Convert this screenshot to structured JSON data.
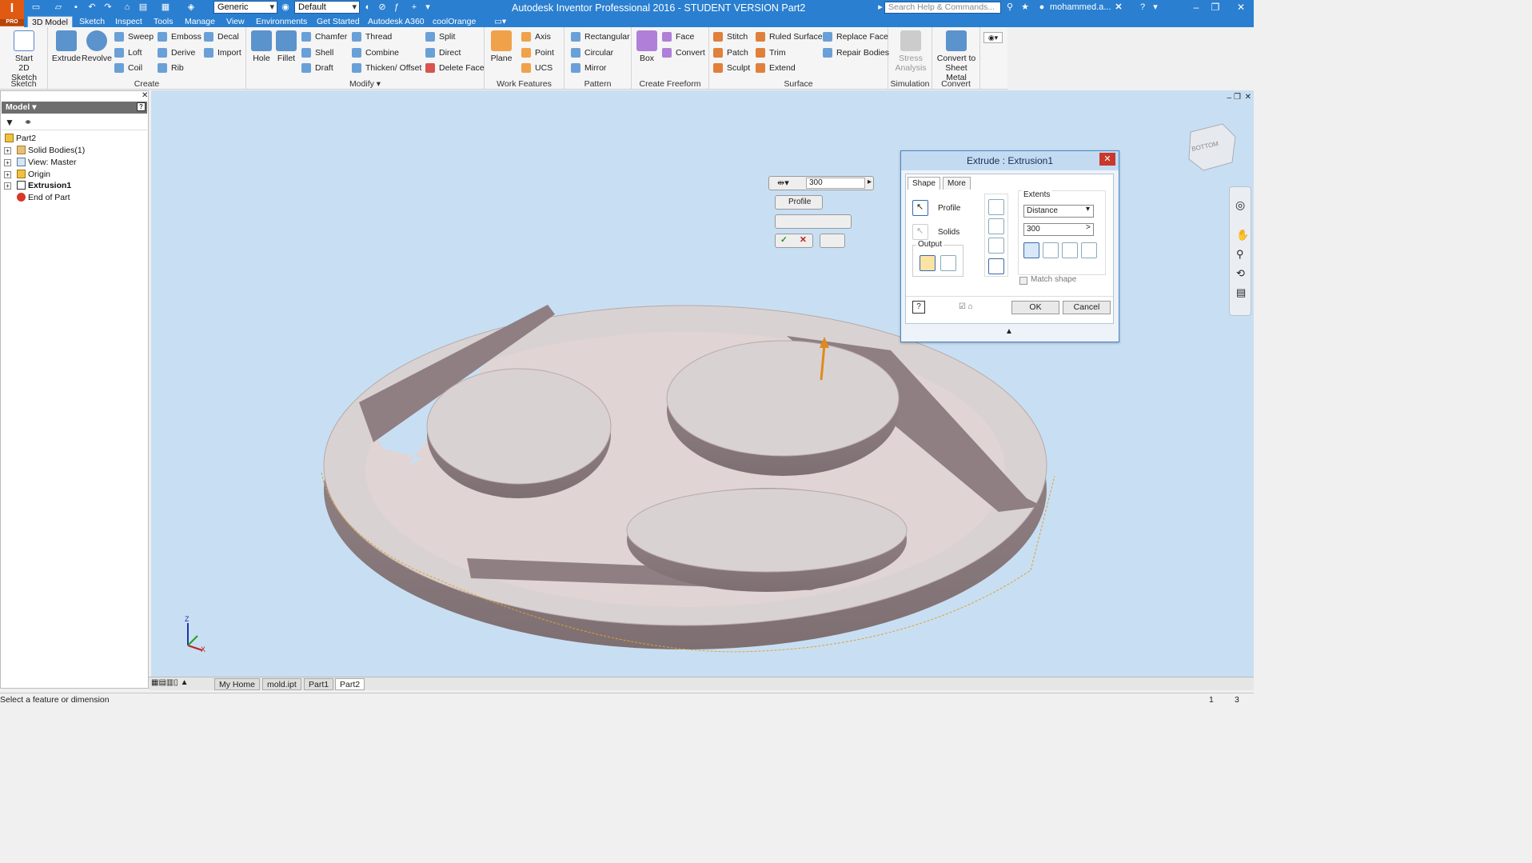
{
  "app": {
    "logo": "I",
    "logo_sub": "PRO",
    "title": "Autodesk Inventor Professional 2016 - STUDENT VERSION    Part2",
    "appearance": "Generic",
    "style": "Default",
    "search_placeholder": "Search Help & Commands...",
    "user": "mohammed.a..."
  },
  "ribbon_tabs": [
    "3D Model",
    "Sketch",
    "Inspect",
    "Tools",
    "Manage",
    "View",
    "Environments",
    "Get Started",
    "Autodesk A360",
    "coolOrange"
  ],
  "active_tab": "3D Model",
  "ribbon": {
    "sketch": {
      "label": "Sketch",
      "start": "Start",
      "start2": "2D Sketch"
    },
    "create": {
      "label": "Create",
      "extrude": "Extrude",
      "revolve": "Revolve",
      "sweep": "Sweep",
      "loft": "Loft",
      "coil": "Coil",
      "emboss": "Emboss",
      "derive": "Derive",
      "rib": "Rib",
      "decal": "Decal",
      "import": "Import"
    },
    "modify": {
      "label": "Modify ▾",
      "hole": "Hole",
      "fillet": "Fillet",
      "chamfer": "Chamfer",
      "shell": "Shell",
      "draft": "Draft",
      "thread": "Thread",
      "combine": "Combine",
      "thicken": "Thicken/ Offset",
      "split": "Split",
      "direct": "Direct",
      "delete_face": "Delete Face"
    },
    "work_features": {
      "label": "Work Features",
      "plane": "Plane",
      "axis": "Axis",
      "point": "Point",
      "ucs": "UCS"
    },
    "pattern": {
      "label": "Pattern",
      "rectangular": "Rectangular",
      "circular": "Circular",
      "mirror": "Mirror"
    },
    "freeform": {
      "label": "Create Freeform",
      "box": "Box",
      "face": "Face",
      "convert": "Convert"
    },
    "surface": {
      "label": "Surface",
      "stitch": "Stitch",
      "patch": "Patch",
      "sculpt": "Sculpt",
      "ruled": "Ruled Surface",
      "trim": "Trim",
      "extend": "Extend",
      "replace": "Replace Face",
      "repair": "Repair Bodies"
    },
    "simulation": {
      "label": "Simulation",
      "stress1": "Stress",
      "stress2": "Analysis"
    },
    "convert": {
      "label": "Convert",
      "sm1": "Convert to",
      "sm2": "Sheet Metal"
    }
  },
  "model_panel": {
    "title": "Model ▾",
    "items": [
      {
        "label": "Part2"
      },
      {
        "label": "Solid Bodies(1)"
      },
      {
        "label": "View: Master"
      },
      {
        "label": "Origin"
      },
      {
        "label": "Extrusion1"
      },
      {
        "label": "End of Part"
      }
    ]
  },
  "minitoolbar": {
    "distance": "300",
    "profile": "Profile"
  },
  "dialog": {
    "title": "Extrude : Extrusion1",
    "tabs": [
      "Shape",
      "More"
    ],
    "profile_label": "Profile",
    "solids_label": "Solids",
    "output_label": "Output",
    "extents_label": "Extents",
    "extents_value": "Distance",
    "distance_value": "300",
    "match_shape": "Match shape",
    "ok": "OK",
    "cancel": "Cancel"
  },
  "viewcube_label": "BOTTOM",
  "doc_tabs": [
    "My Home",
    "mold.ipt",
    "Part1",
    "Part2"
  ],
  "active_doc": "Part2",
  "status": {
    "text": "Select a feature or dimension",
    "n1": "1",
    "n2": "3"
  },
  "triad": {
    "z": "Z",
    "x": "X"
  },
  "colors": {
    "title_bar": "#2a7fd0",
    "viewport": "#c8dff3",
    "brand": "#e05a12",
    "part_top": "#d9d2d2",
    "part_wall": "#8f7f82"
  }
}
